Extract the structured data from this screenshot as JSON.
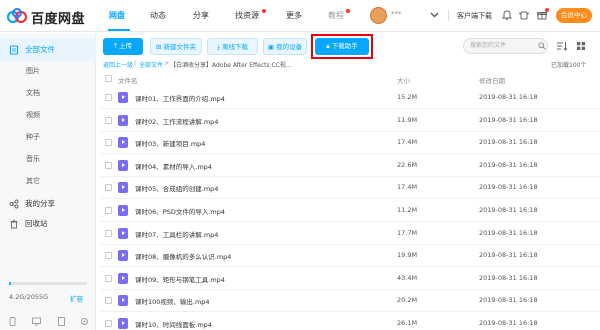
{
  "app": {
    "title": "百度网盘"
  },
  "nav": [
    "网盘",
    "动态",
    "分享",
    "找资源",
    "更多",
    "教程"
  ],
  "user": {
    "name": "***",
    "client_download": "客户端下载",
    "vip": "会员中心"
  },
  "sidebar": {
    "all_files": "全部文件",
    "sub_items": [
      "图片",
      "文档",
      "视频",
      "种子",
      "音乐",
      "其它"
    ],
    "my_share": "我的分享",
    "recycle": "回收站",
    "quota": "4.2G/2055G",
    "quota_fraction": 0.002,
    "expand": "扩容"
  },
  "toolbar": {
    "upload": "上传",
    "new_folder": "新建文件夹",
    "offline_download": "离线下载",
    "my_device": "我的设备",
    "download_helper": "下载助手",
    "search_placeholder": "搜索您的文件"
  },
  "breadcrumb": {
    "back": "返回上一级",
    "all": "全部文件",
    "current": "【白酒收分享】Adobe After Effects CC视..."
  },
  "file_count": "已加载100个",
  "table": {
    "headers": {
      "name": "文件名",
      "size": "大小",
      "date": "修改日期"
    },
    "rows": [
      {
        "name": "课时01、工作界面的介绍.mp4",
        "size": "15.2M",
        "date": "2019-08-31 16:18"
      },
      {
        "name": "课时02、工作流程讲解.mp4",
        "size": "11.9M",
        "date": "2019-08-31 16:18"
      },
      {
        "name": "课时03、新建项目.mp4",
        "size": "17.4M",
        "date": "2019-08-31 16:18"
      },
      {
        "name": "课时04、素材的导入.mp4",
        "size": "22.6M",
        "date": "2019-08-31 16:18"
      },
      {
        "name": "课时05、合成组的创建.mp4",
        "size": "17.4M",
        "date": "2019-08-31 16:18"
      },
      {
        "name": "课时06、PSD文件的导入.mp4",
        "size": "11.2M",
        "date": "2019-08-31 16:18"
      },
      {
        "name": "课时07、工具栏的讲解.mp4",
        "size": "17.7M",
        "date": "2019-08-31 16:18"
      },
      {
        "name": "课时08、摄像机的多么认识.mp4",
        "size": "19.9M",
        "date": "2019-08-31 16:18"
      },
      {
        "name": "课时09、矩形与钢笔工具.mp4",
        "size": "43.4M",
        "date": "2019-08-31 16:18"
      },
      {
        "name": "课时100视频、输出.mp4",
        "size": "20.2M",
        "date": "2019-08-31 16:18"
      },
      {
        "name": "课时10、时间线面板.mp4",
        "size": "26.1M",
        "date": "2019-08-31 16:18"
      }
    ]
  },
  "colors": {
    "accent": "#06a7ff",
    "highlight": "#e50012",
    "vip": "#ff8c1a",
    "video_icon": "#7b6cf6"
  }
}
